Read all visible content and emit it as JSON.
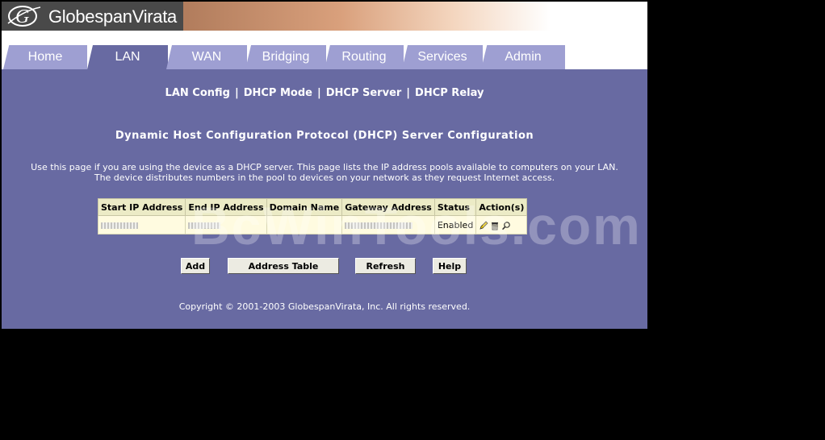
{
  "brand": {
    "name": "GlobespanVirata"
  },
  "tabs": [
    {
      "label": "Home"
    },
    {
      "label": "LAN",
      "active": true
    },
    {
      "label": "WAN"
    },
    {
      "label": "Bridging"
    },
    {
      "label": "Routing"
    },
    {
      "label": "Services"
    },
    {
      "label": "Admin"
    }
  ],
  "subnav": [
    "LAN Config",
    "DHCP Mode",
    "DHCP Server",
    "DHCP Relay"
  ],
  "subnav_separator": "|",
  "page_title": "Dynamic Host Configuration Protocol (DHCP) Server Configuration",
  "description": [
    "Use this page if you are using the device as a DHCP server. This page lists the IP address pools available to computers on your LAN.",
    "The device distributes numbers in the pool to devices on your network as they request Internet access."
  ],
  "table": {
    "headers": [
      "Start IP Address",
      "End IP Address",
      "Domain Name",
      "Gateway Address",
      "Status",
      "Action(s)"
    ],
    "rows": [
      {
        "start_ip": "",
        "end_ip": "",
        "domain": "",
        "gateway": "",
        "status": "Enabled",
        "actions": [
          "edit-icon",
          "delete-icon",
          "view-icon"
        ]
      }
    ]
  },
  "buttons": {
    "add": "Add",
    "address_table": "Address Table",
    "refresh": "Refresh",
    "help": "Help"
  },
  "copyright": "Copyright © 2001-2003 GlobespanVirata, Inc. All rights reserved.",
  "watermark": "BcWinTools.com",
  "colors": {
    "panel": "#686aa2",
    "tab": "#9e9fd2",
    "table_header": "#ecebc6",
    "table_body": "#fffbe0"
  }
}
